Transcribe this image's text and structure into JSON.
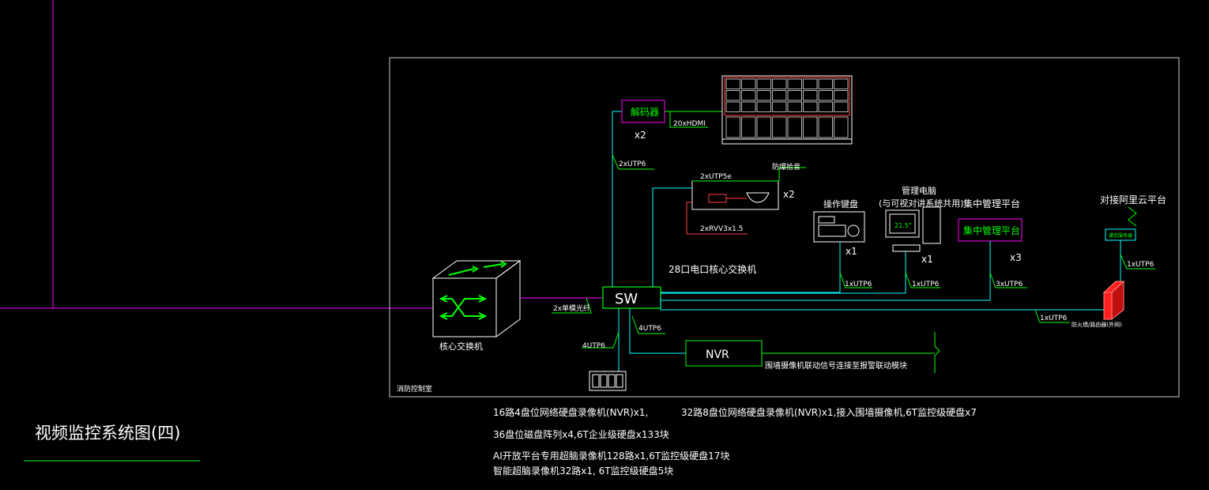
{
  "title": "视频监控系统图(四)",
  "room_label": "消防控制室",
  "core_switch": {
    "label": "核心交换机"
  },
  "core_link": "2x单模光纤",
  "sw": {
    "label": "SW",
    "caption": "28口电口核心交换机"
  },
  "decoder": {
    "label": "解码器",
    "count": "x2",
    "hdmi": "20xHDMI",
    "uplink": "2xUTP6"
  },
  "camera_unit": {
    "top_cable": "2xUTP5e",
    "top_label": "防爆拾音",
    "count": "x2",
    "power_cable": "2xRVV3x1.5"
  },
  "keyboard": {
    "label": "操作键盘",
    "count": "x1",
    "cable": "1xUTP6"
  },
  "pc": {
    "label1": "管理电脑",
    "label2": "(与可视对讲系统共用)",
    "count": "x1",
    "cable": "1xUTP6",
    "screen": "21.5\""
  },
  "central": {
    "label": "集中管理平台",
    "box_label": "集中管理平台",
    "count": "x3",
    "cable": "3xUTP6"
  },
  "cloud": {
    "label": "对接阿里云平台",
    "cable": "1xUTP6"
  },
  "firewall": {
    "cable": "1xUTP6",
    "label": "防火墙/路由器(外网)"
  },
  "nvr": {
    "label": "NVR",
    "cable": "4UTP6",
    "note": "围墙摄像机联动信号连接至报警联动模块"
  },
  "disk": {
    "cable": "4UTP6"
  },
  "notes": {
    "line1": "16路4盘位网络硬盘录像机(NVR)x1,",
    "line1_right": "32路8盘位网络硬盘录像机(NVR)x1,接入围墙摄像机,6T监控级硬盘x7",
    "line2": "36盘位磁盘阵列x4,6T企业级硬盘x133块",
    "line3": "AI开放平台专用超脑录像机128路x1,6T监控级硬盘17块",
    "line4": "智能超脑录像机32路x1, 6T监控级硬盘5块"
  },
  "colors": {
    "background": "#000000",
    "cable": "#00ffff",
    "label": "#00ff00",
    "outline": "#ffffff",
    "magenta": "#ff00ff"
  }
}
